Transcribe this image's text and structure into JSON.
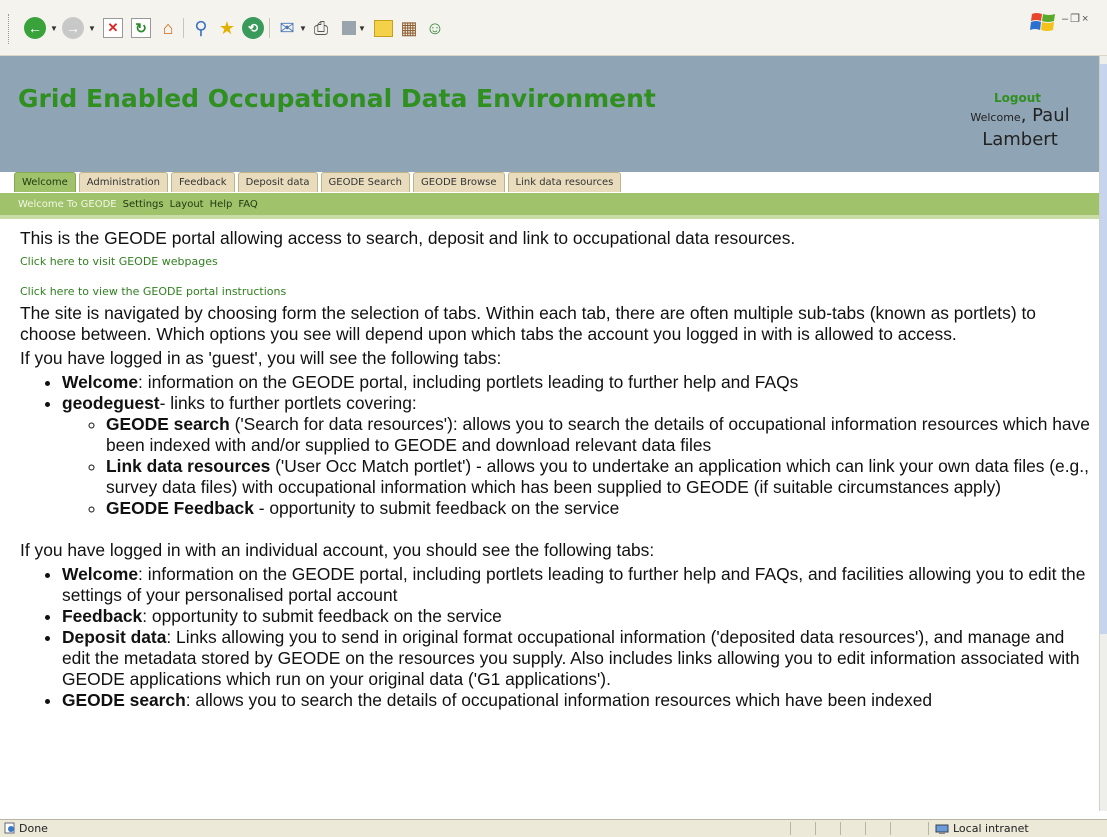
{
  "toolbar": {
    "icons": [
      "back-icon",
      "forward-icon",
      "stop-icon",
      "refresh-icon",
      "home-icon",
      "search-icon",
      "favorites-icon",
      "history-icon",
      "mail-icon",
      "print-icon",
      "edit-icon",
      "discuss-icon",
      "research-icon",
      "messenger-icon"
    ]
  },
  "header": {
    "title": "Grid Enabled Occupational Data Environment",
    "logout": "Logout",
    "welcome_prefix": "Welcome",
    "user_name": "Paul Lambert"
  },
  "tabs": [
    {
      "label": "Welcome",
      "active": true
    },
    {
      "label": "Administration"
    },
    {
      "label": "Feedback"
    },
    {
      "label": "Deposit data"
    },
    {
      "label": "GEODE Search"
    },
    {
      "label": "GEODE Browse"
    },
    {
      "label": "Link data resources"
    }
  ],
  "subnav": {
    "items": [
      "Welcome To GEODE",
      "Settings",
      "Layout",
      "Help",
      "FAQ"
    ]
  },
  "content": {
    "intro": "This is the GEODE portal allowing access to search, deposit and link to occupational data resources.",
    "link_webpages": "Click here to visit GEODE webpages",
    "link_instructions": "Click here to view the GEODE portal instructions",
    "nav_paragraph": "The site is navigated by choosing form the selection of tabs. Within each tab, there are often multiple sub-tabs (known as portlets) to choose between. Which options you see will depend upon which tabs the account you logged in with is allowed to access.",
    "guest_intro": "If you have logged in as 'guest', you will see the following tabs:",
    "guest_items": [
      {
        "bold": "Welcome",
        "text": ": information on the GEODE portal, including portlets leading to further help and FAQs"
      },
      {
        "bold": "geodeguest",
        "text": "- links to further portlets covering:"
      }
    ],
    "guest_sub_items": [
      {
        "bold": "GEODE search",
        "text": " ('Search for data resources'): allows you to search the details of occupational information resources which have been indexed with and/or supplied to GEODE and download relevant data files"
      },
      {
        "bold": "Link data resources",
        "text": " ('User Occ Match portlet') - allows you to undertake an application which can link your own data files (e.g., survey data files) with occupational information which has been supplied to GEODE (if suitable circumstances apply)"
      },
      {
        "bold": "GEODE Feedback",
        "text": " - opportunity to submit feedback on the service"
      }
    ],
    "individual_intro": "If you have logged in with an individual account, you should see the following tabs:",
    "individual_items": [
      {
        "bold": "Welcome",
        "text": ": information on the GEODE portal, including portlets leading to further help and FAQs, and facilities allowing you to edit the settings of your personalised portal account"
      },
      {
        "bold": "Feedback",
        "text": ": opportunity to submit feedback on the service"
      },
      {
        "bold": "Deposit data",
        "text": ": Links allowing you to send in original format occupational information ('deposited data resources'), and manage and edit the metadata stored by GEODE on the resources you supply. Also includes links allowing you to edit information associated with GEODE applications which run on your original data ('G1 applications')."
      },
      {
        "bold": "GEODE search",
        "text": ": allows you to search the details of occupational information resources which have been indexed"
      }
    ]
  },
  "statusbar": {
    "status": "Done",
    "zone": "Local intranet"
  },
  "colors": {
    "header_bg": "#8fa5b5",
    "title_green": "#2f8f1f",
    "tab_active": "#9fc26a",
    "tab_inactive": "#e8dcbc"
  }
}
